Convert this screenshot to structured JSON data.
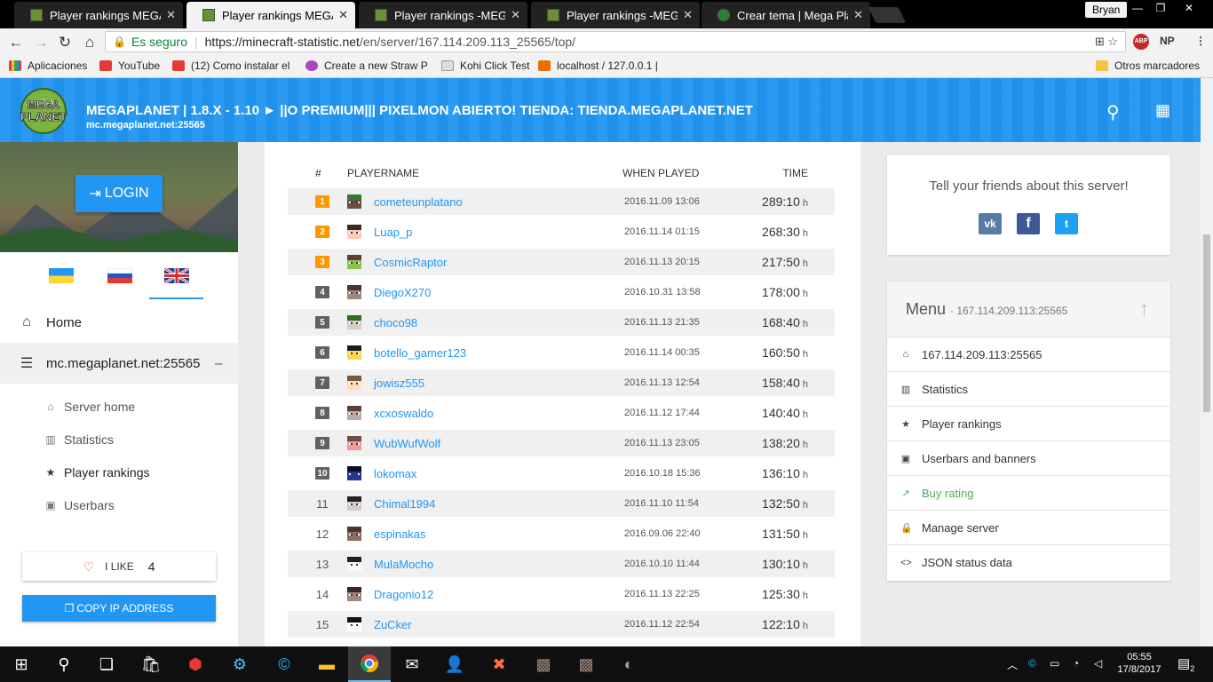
{
  "browser": {
    "tabs": [
      {
        "title": "Player rankings MEGAPla",
        "active": false
      },
      {
        "title": "Player rankings MEGAPla",
        "active": true
      },
      {
        "title": "Player rankings -MEGA P",
        "active": false
      },
      {
        "title": "Player rankings -MEGA P",
        "active": false
      },
      {
        "title": "Crear tema | Mega Plane",
        "active": false
      }
    ],
    "user": "Bryan",
    "secure_label": "Es seguro",
    "url_host": "https://minecraft-statistic.net",
    "url_path": "/en/server/167.114.209.113_25565/top/",
    "ext_abp": "ABP",
    "ext_np": "NP",
    "bookmarks": [
      "Aplicaciones",
      "YouTube",
      "(12) Como instalar el",
      "Create a new Straw P",
      "Kohi Click Test",
      "localhost / 127.0.0.1 |",
      "Otros marcadores"
    ]
  },
  "header": {
    "title": "MEGAPLANET | 1.8.X - 1.10 ► ||O PREMIUM||| PIXELMON ABIERTO! TIENDA: TIENDA.MEGAPLANET.NET",
    "address": "mc.megaplanet.net:25565",
    "logo_text": "MEGA PLANET"
  },
  "sidebar": {
    "login_label": "LOGIN",
    "home_label": "Home",
    "server_label": "mc.megaplanet.net:25565",
    "server_collapse": "–",
    "sub_items": [
      "Server home",
      "Statistics",
      "Player rankings",
      "Userbars"
    ],
    "like_label": "I LIKE",
    "like_count": "4",
    "copy_label": "COPY IP ADDRESS"
  },
  "table": {
    "headers": {
      "rank": "#",
      "name": "PLAYERNAME",
      "when": "WHEN PLAYED",
      "time": "TIME"
    },
    "time_unit": "h",
    "rows": [
      {
        "rank": "1",
        "name": "cometeunplatano",
        "date": "2016.11.09 13:06",
        "time": "289:10"
      },
      {
        "rank": "2",
        "name": "Luap_p",
        "date": "2016.11.14 01:15",
        "time": "268:30"
      },
      {
        "rank": "3",
        "name": "CosmicRaptor",
        "date": "2016.11.13 20:15",
        "time": "217:50"
      },
      {
        "rank": "4",
        "name": "DiegoX270",
        "date": "2016.10.31 13:58",
        "time": "178:00"
      },
      {
        "rank": "5",
        "name": "choco98",
        "date": "2016.11.13 21:35",
        "time": "168:40"
      },
      {
        "rank": "6",
        "name": "botello_gamer123",
        "date": "2016.11.14 00:35",
        "time": "160:50"
      },
      {
        "rank": "7",
        "name": "jowisz555",
        "date": "2016.11.13 12:54",
        "time": "158:40"
      },
      {
        "rank": "8",
        "name": "xcxoswaldo",
        "date": "2016.11.12 17:44",
        "time": "140:40"
      },
      {
        "rank": "9",
        "name": "WubWufWolf",
        "date": "2016.11.13 23:05",
        "time": "138:20"
      },
      {
        "rank": "10",
        "name": "lokomax",
        "date": "2016.10.18 15:36",
        "time": "136:10"
      },
      {
        "rank": "11",
        "name": "Chimal1994",
        "date": "2016.11.10 11:54",
        "time": "132:50"
      },
      {
        "rank": "12",
        "name": "espinakas",
        "date": "2016.09.06 22:40",
        "time": "131:50"
      },
      {
        "rank": "13",
        "name": "MulaMocho",
        "date": "2016.10.10 11:44",
        "time": "130:10"
      },
      {
        "rank": "14",
        "name": "Dragonio12",
        "date": "2016.11.13 22:25",
        "time": "125:30"
      },
      {
        "rank": "15",
        "name": "ZuCker",
        "date": "2016.11.12 22:54",
        "time": "122:10"
      }
    ]
  },
  "share": {
    "text": "Tell your friends about this server!",
    "vk": "vk",
    "fb": "f",
    "tw": "t"
  },
  "menu": {
    "title": "Menu",
    "subtitle": "· 167.114.209.113:25565",
    "items": [
      "167.114.209.113:25565",
      "Statistics",
      "Player rankings",
      "Userbars and banners",
      "Buy rating",
      "Manage server",
      "JSON status data"
    ]
  },
  "taskbar": {
    "time": "05:55",
    "date": "17/8/2017",
    "notifications": "2"
  }
}
